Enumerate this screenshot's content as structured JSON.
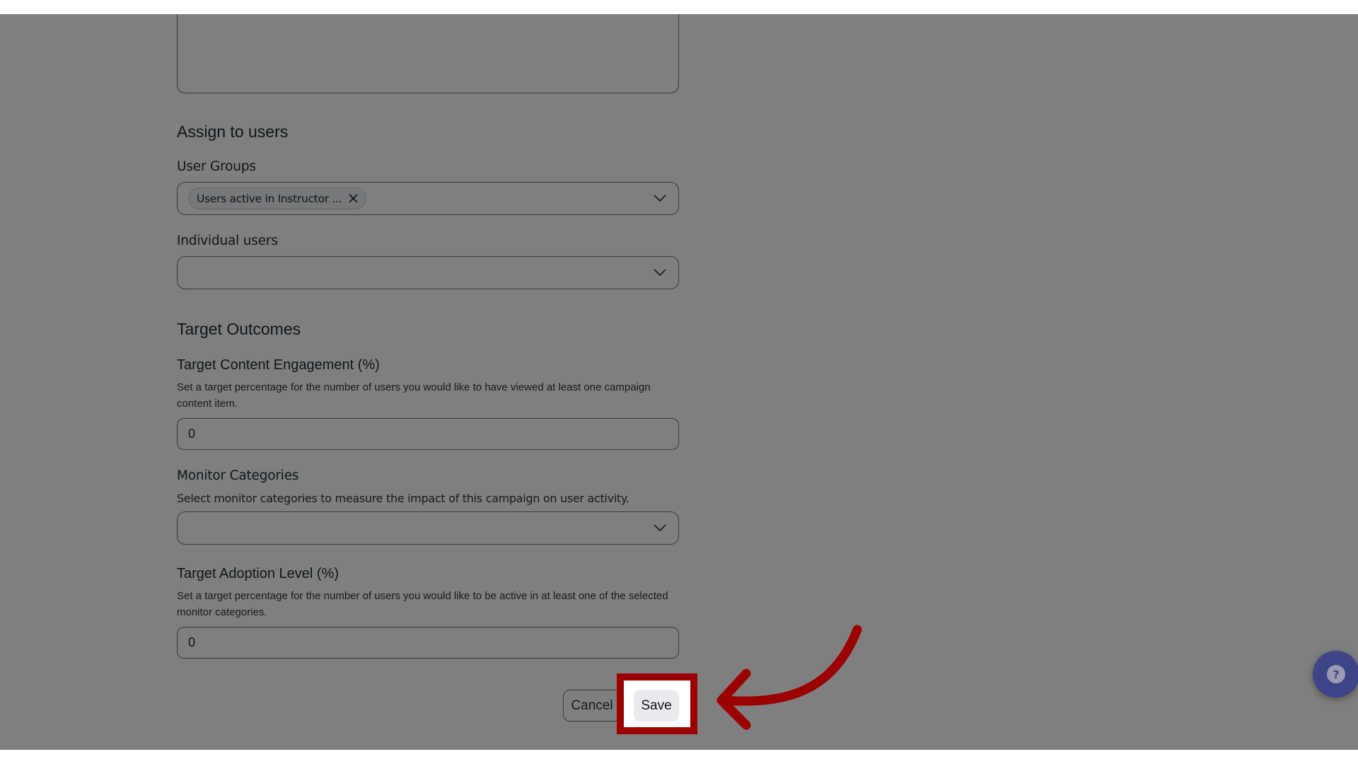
{
  "assign_section": {
    "heading": "Assign to users",
    "user_groups": {
      "label": "User Groups",
      "selected": [
        {
          "label": "Users active in Instructor ..."
        }
      ]
    },
    "individual_users": {
      "label": "Individual users",
      "selected": []
    }
  },
  "outcomes_section": {
    "heading": "Target Outcomes",
    "content_engagement": {
      "label": "Target Content Engagement (%)",
      "help": "Set a target percentage for the number of users you would like to have viewed at least one campaign content item.",
      "value": "0"
    },
    "monitor_categories": {
      "label": "Monitor Categories",
      "help": "Select monitor categories to measure the impact of this campaign on user activity.",
      "selected": []
    },
    "adoption_level": {
      "label": "Target Adoption Level (%)",
      "help": "Set a target percentage for the number of users you would like to be active in at least one of the selected monitor categories.",
      "value": "0"
    }
  },
  "actions": {
    "cancel_label": "Cancel",
    "save_label": "Save"
  },
  "help_widget": {
    "icon": "help-chat-icon",
    "glyph": "?"
  },
  "annotation": {
    "highlight_color": "#9b0000",
    "overlay_color": "#808080",
    "target": "save-button"
  }
}
